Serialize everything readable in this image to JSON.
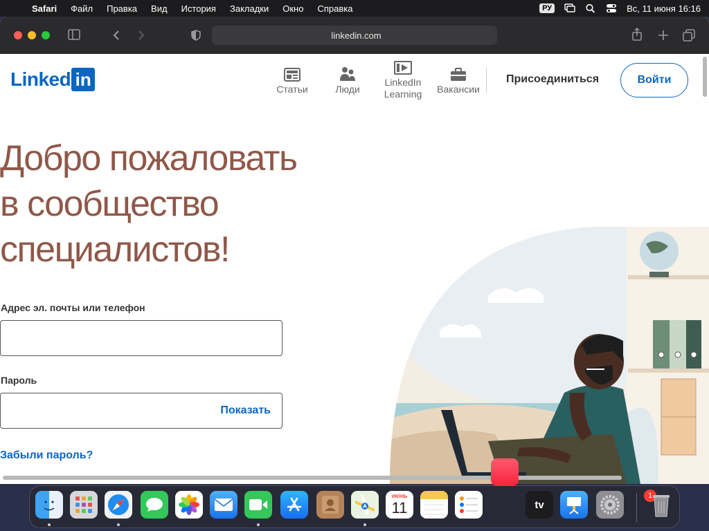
{
  "menubar": {
    "app": "Safari",
    "items": [
      "Файл",
      "Правка",
      "Вид",
      "История",
      "Закладки",
      "Окно",
      "Справка"
    ],
    "keyboard": "РУ",
    "datetime": "Вс, 11 июня  16:16"
  },
  "browser": {
    "url": "linkedin.com"
  },
  "linkedin": {
    "logo_word": "Linked",
    "logo_box": "in",
    "nav": [
      {
        "label": "Статьи",
        "icon": "articles-icon"
      },
      {
        "label": "Люди",
        "icon": "people-icon"
      },
      {
        "label": "LinkedIn Learning",
        "icon": "learning-icon"
      },
      {
        "label": "Вакансии",
        "icon": "jobs-icon"
      }
    ],
    "join": "Присоединиться",
    "signin": "Войти",
    "headline_line1": "Добро пожаловать",
    "headline_line2": "в сообщество",
    "headline_line3": "специалистов!",
    "email_label": "Адрес эл. почты или телефон",
    "email_value": "",
    "password_label": "Пароль",
    "password_value": "",
    "show_password": "Показать",
    "forgot": "Забыли пароль?"
  },
  "dock": {
    "apps": [
      "Finder",
      "Launchpad",
      "Safari",
      "Messages",
      "Photos",
      "Mail",
      "FaceTime",
      "App Store",
      "Contacts",
      "Maps",
      "Calendar",
      "Notes",
      "Reminders",
      "Music",
      "TV",
      "Keynote",
      "System Settings",
      "Trash"
    ],
    "calendar_month": "ИЮНЬ",
    "calendar_day": "11",
    "tv_label": "tv",
    "settings_badge": "1"
  },
  "colors": {
    "linkedin_blue": "#0a66c2",
    "headline": "#8f5849"
  }
}
